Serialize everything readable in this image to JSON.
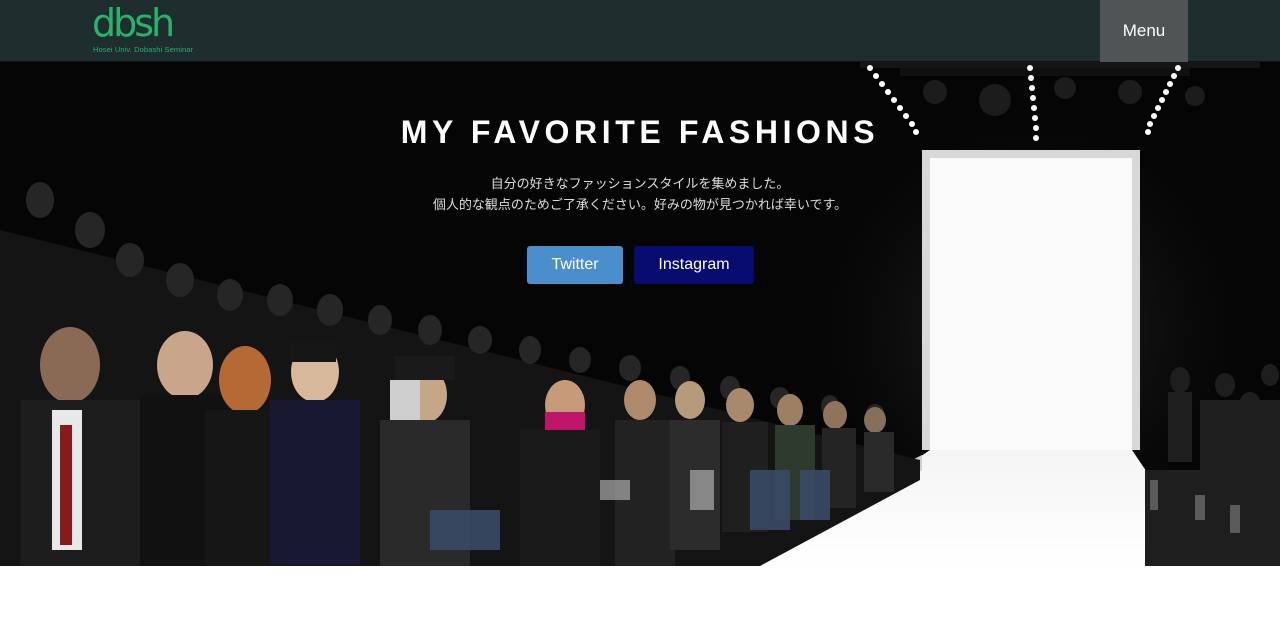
{
  "header": {
    "logo_text": "dbsh",
    "logo_tagline": "Hosei Univ. Dobashi Seminar",
    "menu_label": "Menu"
  },
  "hero": {
    "title": "MY FAVORITE FASHIONS",
    "lead_line1": "自分の好きなファッションスタイルを集めました。",
    "lead_line2": "個人的な観点のためご了承ください。好みの物が見つかれば幸いです。",
    "twitter_label": "Twitter",
    "instagram_label": "Instagram"
  },
  "colors": {
    "header_bg": "#203030",
    "logo_green": "#27b36c",
    "menu_bg": "#4e5554",
    "twitter_blue": "#4a8ecb",
    "instagram_navy": "#080b6f"
  }
}
